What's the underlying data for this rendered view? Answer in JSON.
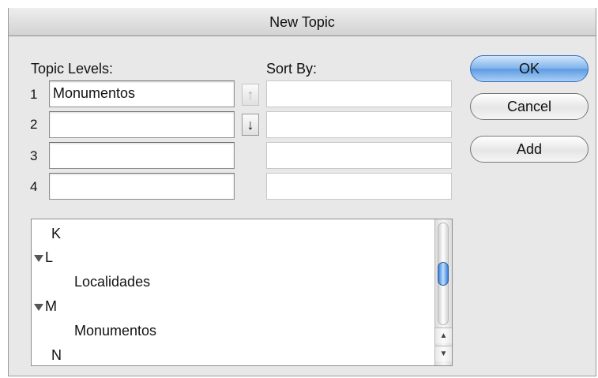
{
  "window": {
    "title": "New Topic"
  },
  "levels": {
    "topic_levels_label": "Topic Levels:",
    "sort_by_label": "Sort By:",
    "rows": [
      {
        "number": "1",
        "value": "Monumentos",
        "sort_value": ""
      },
      {
        "number": "2",
        "value": "",
        "sort_value": ""
      },
      {
        "number": "3",
        "value": "",
        "sort_value": ""
      },
      {
        "number": "4",
        "value": "",
        "sort_value": ""
      }
    ],
    "move_up_icon": "arrow-up-icon",
    "move_down_icon": "arrow-down-icon"
  },
  "buttons": {
    "ok": "OK",
    "cancel": "Cancel",
    "add": "Add"
  },
  "topic_list": {
    "items": [
      {
        "text": "K",
        "kind": "letter",
        "expanded": false
      },
      {
        "text": "L",
        "kind": "letter",
        "expanded": true
      },
      {
        "text": "Localidades",
        "kind": "topic"
      },
      {
        "text": "M",
        "kind": "letter",
        "expanded": true
      },
      {
        "text": "Monumentos",
        "kind": "topic"
      },
      {
        "text": "N",
        "kind": "letter",
        "expanded": false
      }
    ]
  },
  "colors": {
    "default_button": "#5b9be3",
    "scroll_thumb": "#3d7fd6"
  }
}
